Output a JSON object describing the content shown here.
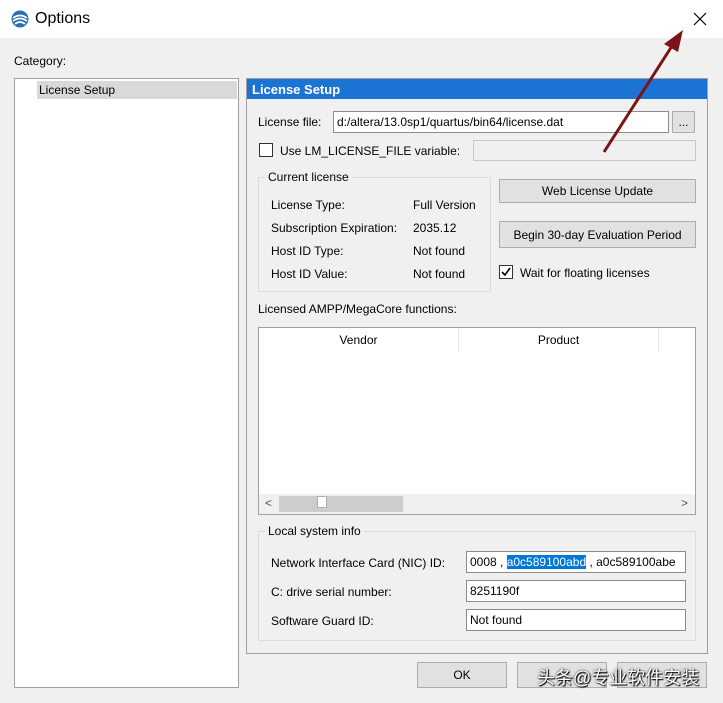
{
  "window": {
    "title": "Options",
    "app_icon": "quartus-globe-icon",
    "close_glyph": "✕"
  },
  "category": {
    "label": "Category:",
    "items": [
      {
        "label": "License Setup",
        "selected": true
      }
    ]
  },
  "panel": {
    "header": "License Setup",
    "license_file_label": "License file:",
    "license_file_value": "d:/altera/13.0sp1/quartus/bin64/license.dat",
    "browse_label": "...",
    "use_lm_label": "Use LM_LICENSE_FILE variable:",
    "use_lm_checked": false,
    "use_lm_value": "",
    "current_license": {
      "title": "Current license",
      "rows": [
        {
          "key": "License Type:",
          "value": "Full Version"
        },
        {
          "key": "Subscription Expiration:",
          "value": "2035.12"
        },
        {
          "key": "Host ID Type:",
          "value": "Not found"
        },
        {
          "key": "Host ID Value:",
          "value": "Not found"
        }
      ]
    },
    "web_license_update_label": "Web License Update",
    "eval_period_label": "Begin 30-day Evaluation Period",
    "wait_floating_label": "Wait for floating licenses",
    "wait_floating_checked": true,
    "ampp_label": "Licensed AMPP/MegaCore functions:",
    "ampp_columns": [
      "Vendor",
      "Product"
    ],
    "scroll_left": "<",
    "scroll_right": ">",
    "local_system": {
      "title": "Local system info",
      "nic_label": "Network Interface Card (NIC) ID:",
      "nic_prefix": "0008 , ",
      "nic_selected": "a0c589100abd",
      "nic_suffix": " , a0c589100abe",
      "drive_label": "C: drive serial number:",
      "drive_value": "8251190f",
      "guard_label": "Software Guard ID:",
      "guard_value": "Not found"
    }
  },
  "footer": {
    "ok_label": "OK",
    "watermark": "头条@专业软件安装"
  },
  "colors": {
    "header_blue": "#1b74d4",
    "selection_blue": "#0078d7",
    "annotation_arrow": "#7a1416"
  }
}
